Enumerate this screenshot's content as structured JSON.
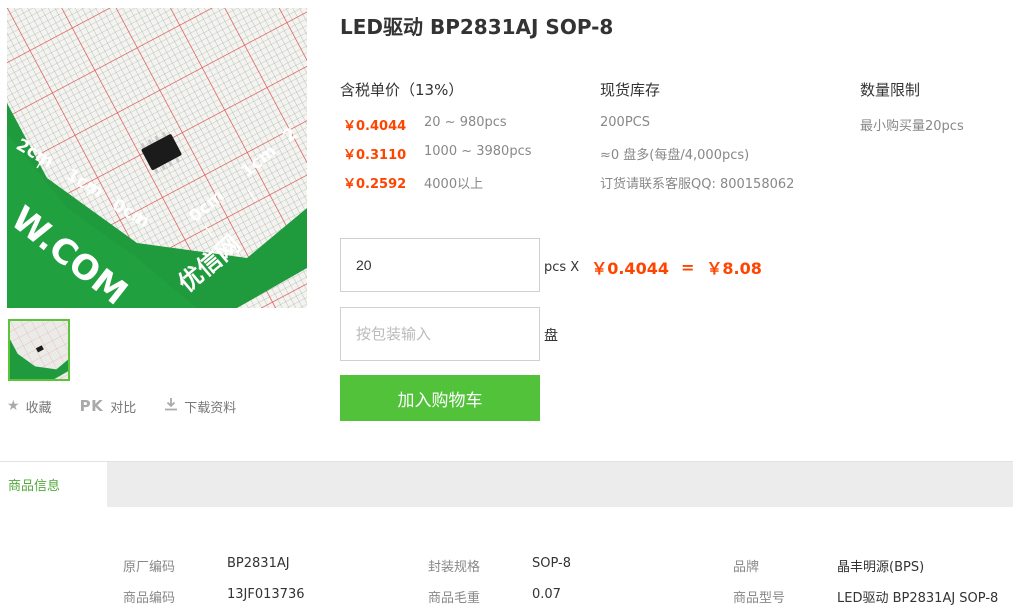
{
  "product": {
    "title": "LED驱动 BP2831AJ SOP-8",
    "image_alt": "BP2831AJ chip on ruler mat"
  },
  "actions": {
    "favorite": "收藏",
    "compare_icon": "PK",
    "compare": "对比",
    "download": "下载资料"
  },
  "pricing": {
    "headers": {
      "price": "含税单价（13%）",
      "stock": "现货库存",
      "limit": "数量限制"
    },
    "rows": [
      {
        "price": "￥0.4044",
        "range": "20 ~ 980pcs",
        "stock": "200PCS",
        "limit": "最小购买量20pcs"
      },
      {
        "price": "￥0.3110",
        "range": "1000 ~ 3980pcs",
        "stock": "≈0 盘多(每盘/4,000pcs)"
      },
      {
        "price": "￥0.2592",
        "range": "4000以上",
        "stock": "订货请联系客服QQ: 800158062"
      }
    ]
  },
  "order": {
    "quantity_value": "20",
    "unit_label": "pcs X",
    "unit_price": "￥0.4044",
    "equals": "=",
    "total": "￥8.08",
    "reel_placeholder": "按包装输入",
    "reel_unit": "盘",
    "add_to_cart": "加入购物车"
  },
  "tabs": {
    "active": "商品信息"
  },
  "specs": [
    {
      "label": "原厂编码",
      "value": "BP2831AJ"
    },
    {
      "label": "封装规格",
      "value": "SOP-8"
    },
    {
      "label": "品牌",
      "value": "晶丰明源(BPS)"
    },
    {
      "label": "商品编码",
      "value": "13JF013736"
    },
    {
      "label": "商品毛重",
      "value": "0.07"
    },
    {
      "label": "商品型号",
      "value": "LED驱动 BP2831AJ SOP-8"
    }
  ],
  "image_text": {
    "tick_2cm_left": "2cm",
    "tick_1cm_left": "1cm",
    "tick_0cm_left": "0cm",
    "tick_0cm_right": "0cm",
    "tick_1cm_right": "1cm",
    "tick_2_right": "2",
    "brand_url": "W.COM",
    "brand_logo": "优信网"
  },
  "colors": {
    "accent_green": "#52c23b",
    "price_orange": "#ff4400",
    "mat_green": "#1f9a3c",
    "grid_red": "#e0504b"
  }
}
